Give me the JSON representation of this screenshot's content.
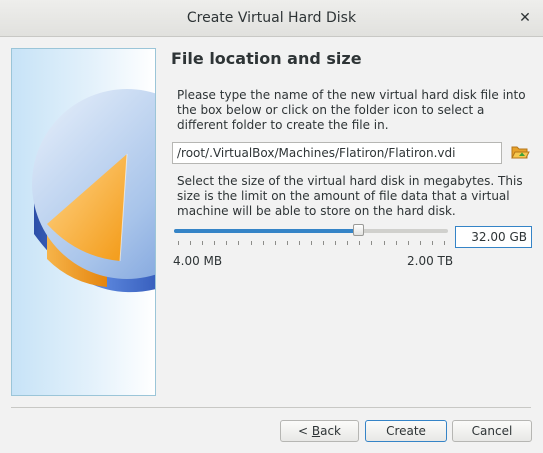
{
  "window": {
    "title": "Create Virtual Hard Disk",
    "close_glyph": "✕"
  },
  "page": {
    "heading": "File location and size",
    "location_description": "Please type the name of the new virtual hard disk file into the box below or click on the folder icon to select a different folder to create the file in.",
    "file_path": "/root/.VirtualBox/Machines/Flatiron/Flatiron.vdi",
    "folder_icon": "folder-open-icon",
    "size_description": "Select the size of the virtual hard disk in megabytes. This size is the limit on the amount of file data that a virtual machine will be able to store on the hard disk.",
    "slider": {
      "fraction": 0.67,
      "min_label": "4.00 MB",
      "max_label": "2.00 TB"
    },
    "size_value": "32.00 GB"
  },
  "buttons": {
    "back_prefix": "< ",
    "back_mnemonic": "B",
    "back_rest": "ack",
    "create": "Create",
    "cancel": "Cancel"
  },
  "colors": {
    "accent": "#3584c7",
    "disk_blue": "#3f6fd0",
    "disk_orange": "#f7a825"
  }
}
